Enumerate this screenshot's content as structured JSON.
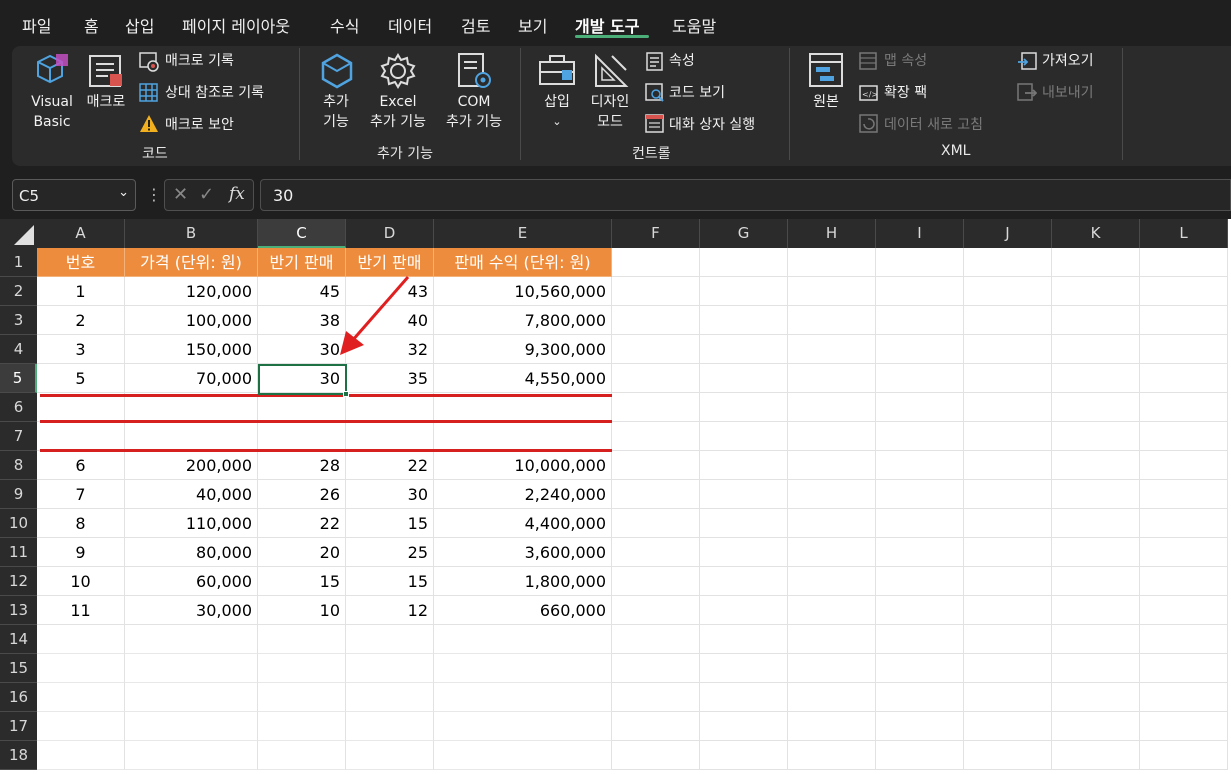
{
  "menubar": {
    "tabs": [
      "파일",
      "홈",
      "삽입",
      "페이지 레이아웃",
      "수식",
      "데이터",
      "검토",
      "보기",
      "개발 도구",
      "도움말"
    ],
    "active": "개발 도구"
  },
  "ribbon": {
    "code": {
      "visual_basic": [
        "Visual",
        "Basic"
      ],
      "macro": "매크로",
      "record_macro": "매크로 기록",
      "relative_ref": "상대 참조로 기록",
      "macro_security": "매크로 보안",
      "group_label": "코드"
    },
    "addins": {
      "addins": [
        "추가",
        "기능"
      ],
      "excel_addins": [
        "Excel",
        "추가 기능"
      ],
      "com_addins": [
        "COM",
        "추가 기능"
      ],
      "group_label": "추가 기능"
    },
    "controls": {
      "insert": "삽입",
      "design_mode": [
        "디자인",
        "모드"
      ],
      "properties": "속성",
      "view_code": "코드 보기",
      "run_dialog": "대화 상자 실행",
      "group_label": "컨트롤"
    },
    "xml": {
      "source": "원본",
      "map_properties": "맵 속성",
      "expansion_packs": "확장 팩",
      "refresh_data": "데이터 새로 고침",
      "import": "가져오기",
      "export": "내보내기",
      "group_label": "XML"
    }
  },
  "formula_bar": {
    "name_box": "C5",
    "fx": "fx",
    "value": "30"
  },
  "columns": [
    "A",
    "B",
    "C",
    "D",
    "E",
    "F",
    "G",
    "H",
    "I",
    "J",
    "K",
    "L"
  ],
  "rows": [
    "1",
    "2",
    "3",
    "4",
    "5",
    "6",
    "7",
    "8",
    "9",
    "10",
    "11",
    "12",
    "13",
    "14",
    "15",
    "16",
    "17",
    "18"
  ],
  "selected_cell": "C5",
  "table": {
    "headers": [
      "번호",
      "가격 (단위: 원)",
      "상반기 판매량",
      "하반기 판매량",
      "판매 수익 (단위: 원)"
    ],
    "headers_visible": [
      "번호",
      "가격 (단위: 원)",
      "반기 판매",
      "반기 판매",
      "판매 수익 (단위: 원)"
    ],
    "rows": [
      [
        "1",
        "120,000",
        "45",
        "43",
        "10,560,000"
      ],
      [
        "2",
        "100,000",
        "38",
        "40",
        "7,800,000"
      ],
      [
        "3",
        "150,000",
        "30",
        "32",
        "9,300,000"
      ],
      [
        "5",
        "70,000",
        "30",
        "35",
        "4,550,000"
      ],
      [
        "",
        "",
        "",
        "",
        ""
      ],
      [
        "",
        "",
        "",
        "",
        ""
      ],
      [
        "6",
        "200,000",
        "28",
        "22",
        "10,000,000"
      ],
      [
        "7",
        "40,000",
        "26",
        "30",
        "2,240,000"
      ],
      [
        "8",
        "110,000",
        "22",
        "15",
        "4,400,000"
      ],
      [
        "9",
        "80,000",
        "20",
        "25",
        "3,600,000"
      ],
      [
        "10",
        "60,000",
        "15",
        "15",
        "1,800,000"
      ],
      [
        "11",
        "30,000",
        "10",
        "12",
        "660,000"
      ]
    ]
  },
  "colors": {
    "header_fill": "#ee8c3d",
    "annotation_red": "#d62020",
    "selection_green": "#1e7145"
  }
}
